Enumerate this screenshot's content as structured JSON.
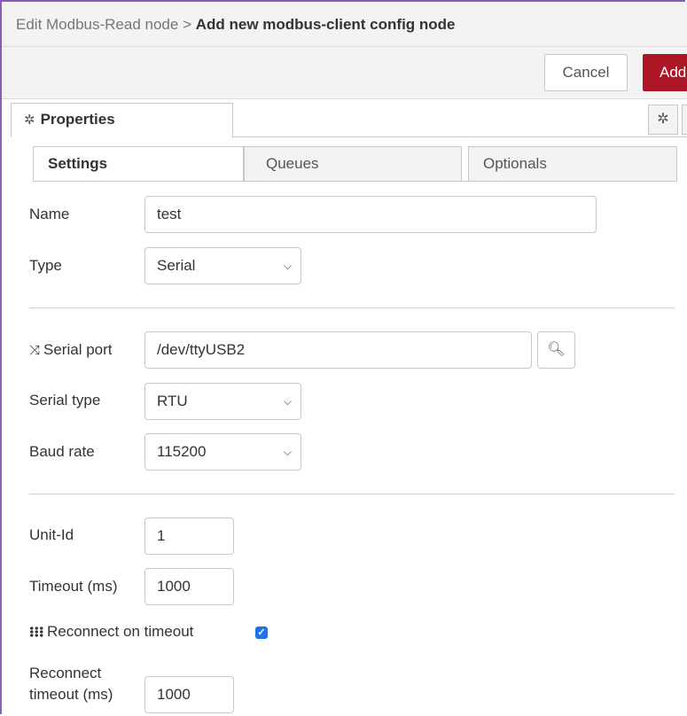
{
  "header": {
    "breadcrumb_prefix": "Edit Modbus-Read node >",
    "title": "Add new modbus-client config node"
  },
  "toolbar": {
    "cancel_label": "Cancel",
    "add_label": "Add"
  },
  "tabs": {
    "properties_label": "Properties"
  },
  "subtabs": [
    {
      "label": "Settings",
      "active": true
    },
    {
      "label": "Queues",
      "active": false
    },
    {
      "label": "Optionals",
      "active": false
    }
  ],
  "form": {
    "name": {
      "label": "Name",
      "value": "test"
    },
    "type": {
      "label": "Type",
      "value": "Serial"
    },
    "serial_port": {
      "label": "Serial port",
      "value": "/dev/ttyUSB2",
      "icon": "shuffle-icon"
    },
    "serial_type": {
      "label": "Serial type",
      "value": "RTU"
    },
    "baud_rate": {
      "label": "Baud rate",
      "value": "115200"
    },
    "unit_id": {
      "label": "Unit-Id",
      "value": "1"
    },
    "timeout": {
      "label": "Timeout (ms)",
      "value": "1000"
    },
    "reconnect_on_timeout": {
      "label": "Reconnect on timeout",
      "checked": true,
      "icon": "grid-icon"
    },
    "reconnect_timeout": {
      "label_line1": "Reconnect",
      "label_line2": "timeout (ms)",
      "value": "1000"
    }
  },
  "colors": {
    "primary": "#ad1625",
    "checkbox": "#1a73e8",
    "frame": "#8a5cc0"
  }
}
